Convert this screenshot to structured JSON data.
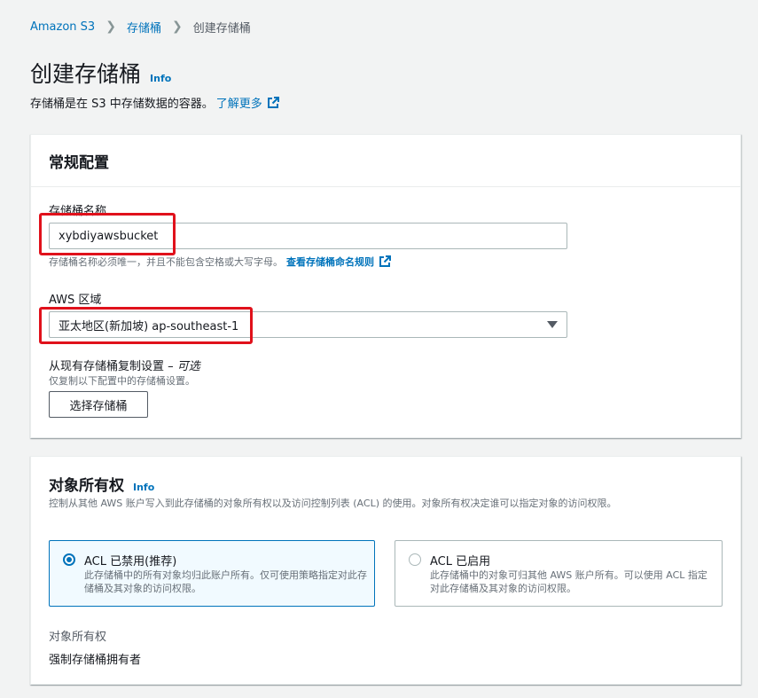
{
  "breadcrumb": {
    "items": [
      "Amazon S3",
      "存储桶",
      "创建存储桶"
    ]
  },
  "page": {
    "title": "创建存储桶",
    "info": "Info",
    "description": "存储桶是在 S3 中存储数据的容器。",
    "learn_more": "了解更多"
  },
  "general": {
    "header": "常规配置",
    "bucket_name_label": "存储桶名称",
    "bucket_name_value": "xybdiyawsbucket",
    "bucket_name_hint": "存储桶名称必须唯一，并且不能包含空格或大写字母。",
    "bucket_rules_link": "查看存储桶命名规则",
    "region_label": "AWS 区域",
    "region_value": "亚太地区(新加坡) ap-southeast-1",
    "copy_label": "从现有存储桶复制设置 –",
    "copy_optional": "可选",
    "copy_hint": "仅复制以下配置中的存储桶设置。",
    "choose_bucket_button": "选择存储桶"
  },
  "ownership": {
    "header": "对象所有权",
    "info": "Info",
    "description": "控制从其他 AWS 账户写入到此存储桶的对象所有权以及访问控制列表 (ACL) 的使用。对象所有权决定谁可以指定对象的访问权限。",
    "options": [
      {
        "title": "ACL 已禁用(推荐)",
        "desc": "此存储桶中的所有对象均归此账户所有。仅可使用策略指定对此存储桶及其对象的访问权限。",
        "selected": true
      },
      {
        "title": "ACL 已启用",
        "desc": "此存储桶中的对象可归其他 AWS 账户所有。可以使用 ACL 指定对此存储桶及其对象的访问权限。",
        "selected": false
      }
    ],
    "ownership_label": "对象所有权",
    "ownership_value": "强制存储桶拥有者"
  },
  "colors": {
    "link": "#0073bb",
    "highlight": "#e0111b",
    "background": "#f2f3f3"
  }
}
